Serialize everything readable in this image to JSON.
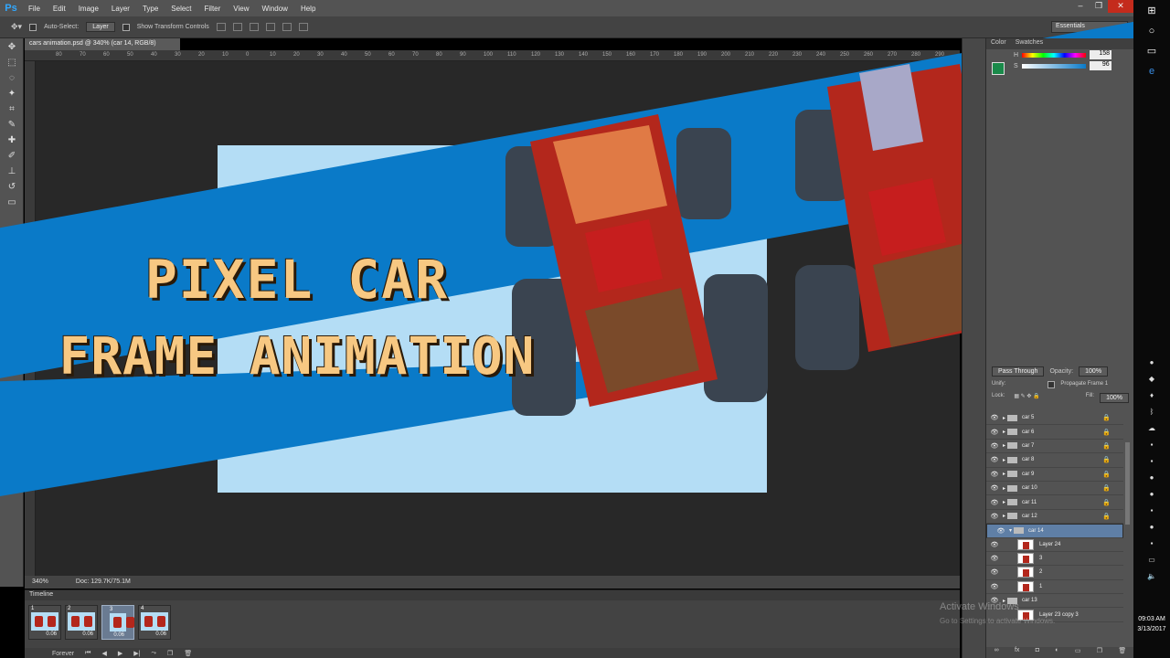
{
  "menubar": {
    "logo": "Ps",
    "items": [
      "File",
      "Edit",
      "Image",
      "Layer",
      "Type",
      "Select",
      "Filter",
      "View",
      "Window",
      "Help"
    ]
  },
  "options": {
    "auto_select_label": "Auto-Select:",
    "auto_select_value": "Layer",
    "transform_label": "Show Transform Controls",
    "workspace": "Essentials"
  },
  "document": {
    "tab": "cars animation.psd @ 340% (car 14, RGB/8)",
    "zoom": "340%",
    "doc_size": "Doc: 129.7K/75.1M"
  },
  "ruler_ticks": [
    "80",
    "70",
    "60",
    "50",
    "40",
    "30",
    "20",
    "10",
    "0",
    "10",
    "20",
    "30",
    "40",
    "50",
    "60",
    "70",
    "80",
    "90",
    "100",
    "110",
    "120",
    "130",
    "140",
    "150",
    "160",
    "170",
    "180",
    "190",
    "200",
    "210",
    "220",
    "230",
    "240",
    "250",
    "260",
    "270",
    "280",
    "290"
  ],
  "timeline": {
    "title": "Timeline",
    "frames": [
      {
        "num": "1",
        "delay": "0.06"
      },
      {
        "num": "2",
        "delay": "0.06"
      },
      {
        "num": "3",
        "delay": "0.06"
      },
      {
        "num": "4",
        "delay": "0.06"
      }
    ],
    "loop": "Forever"
  },
  "color_panel": {
    "tabs": [
      "Color",
      "Swatches"
    ],
    "h_label": "H",
    "h_value": "158",
    "s_label": "S",
    "s_value": "96"
  },
  "layers_panel": {
    "blend": "Pass Through",
    "opacity_label": "Opacity:",
    "opacity": "100%",
    "unify_label": "Unify:",
    "propagate": "Propagate Frame 1",
    "lock_label": "Lock:",
    "fill_label": "Fill:",
    "fill": "100%",
    "rows": [
      {
        "name": "car 5",
        "type": "group"
      },
      {
        "name": "car 6",
        "type": "group"
      },
      {
        "name": "car 7",
        "type": "group"
      },
      {
        "name": "car 8",
        "type": "group"
      },
      {
        "name": "car 9",
        "type": "group"
      },
      {
        "name": "car 10",
        "type": "group"
      },
      {
        "name": "car 11",
        "type": "group"
      },
      {
        "name": "car 12",
        "type": "group"
      },
      {
        "name": "car 14",
        "type": "group-open"
      },
      {
        "name": "Layer 24",
        "type": "layer"
      },
      {
        "name": "3",
        "type": "layer"
      },
      {
        "name": "2",
        "type": "layer"
      },
      {
        "name": "1",
        "type": "layer"
      },
      {
        "name": "car 13",
        "type": "group"
      },
      {
        "name": "Layer 23 copy 3",
        "type": "layer"
      }
    ]
  },
  "banner": {
    "line1": "PIXEL CAR",
    "line2": "FRAME ANIMATION"
  },
  "watermark": {
    "line1": "Activate Windows",
    "line2": "Go to Settings to activate Windows."
  },
  "clock": {
    "time": "09:03 AM",
    "date": "3/13/2017"
  },
  "colors": {
    "banner": "#0a7ac8",
    "title": "#f7c882",
    "car_body": "#b3271c",
    "canvas": "#b4ddf5"
  }
}
